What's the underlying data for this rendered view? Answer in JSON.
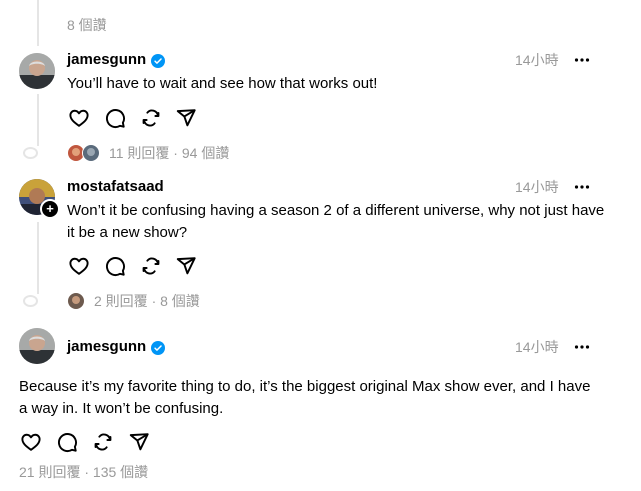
{
  "top": {
    "stats": "8 個讚"
  },
  "posts": [
    {
      "username": "jamesgunn",
      "time": "14小時",
      "text": "You’ll have to wait and see how that works out!",
      "stats": "11 則回覆 · 94 個讚"
    },
    {
      "username": "mostafatsaad",
      "time": "14小時",
      "text": "Won’t it be confusing having a season 2 of a different universe, why not just have it be a new show?",
      "stats": "2 則回覆 · 8 個讚"
    },
    {
      "username": "jamesgunn",
      "time": "14小時",
      "text": "Because it’s my favorite thing to do, it’s the biggest original Max show ever, and I have a way in. It won’t be confusing.",
      "stats": "21 則回覆 · 135 個讚"
    }
  ],
  "colors": {
    "verified": "#0095f6",
    "muted": "#999999",
    "line": "#e5e5e5"
  },
  "icons": [
    "heart-icon",
    "comment-icon",
    "repost-icon",
    "share-icon",
    "more-icon",
    "verified-badge-icon",
    "follow-plus-icon"
  ]
}
